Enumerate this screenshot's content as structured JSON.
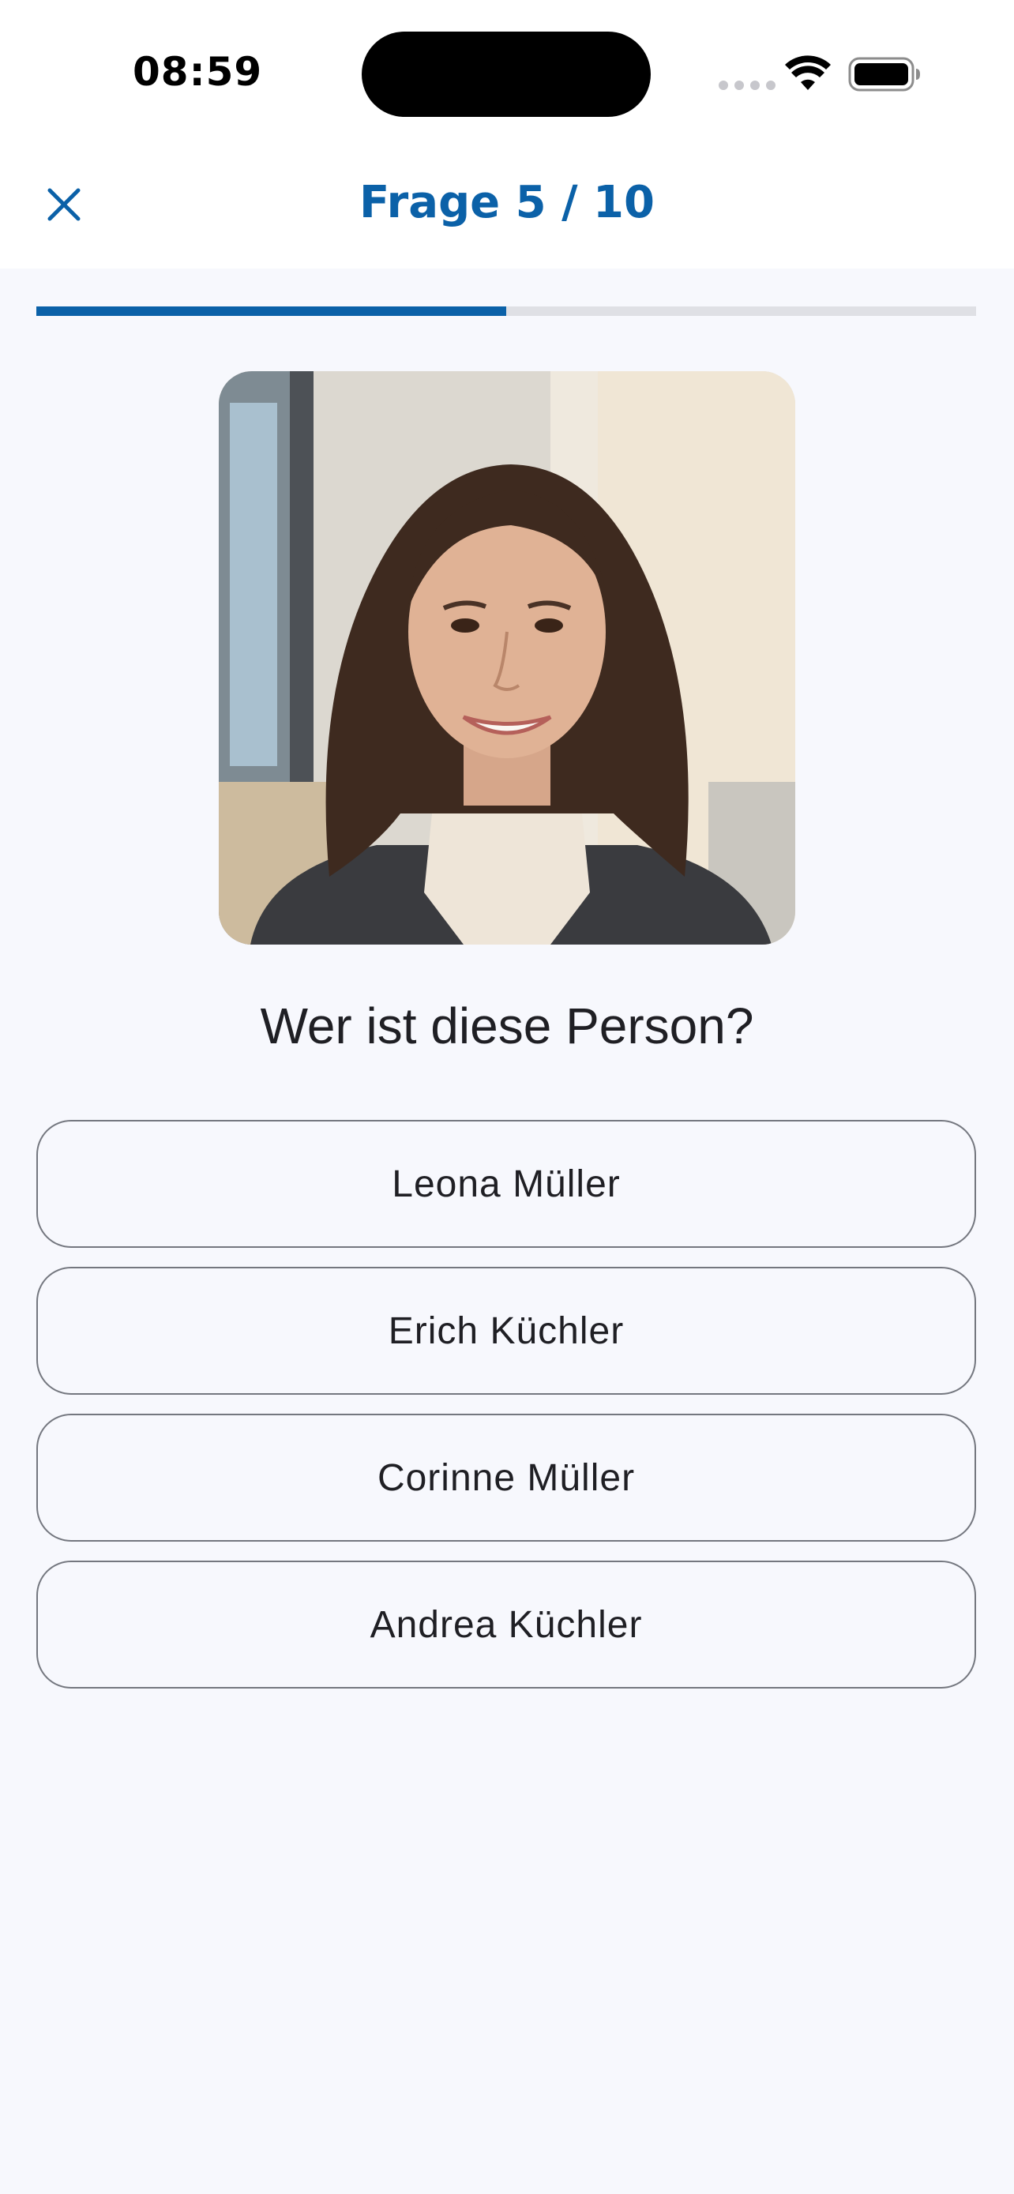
{
  "status_bar": {
    "time": "08:59"
  },
  "header": {
    "title": "Frage 5 / 10",
    "close_icon": "close-icon"
  },
  "progress": {
    "current": 5,
    "total": 10,
    "fraction": 0.5
  },
  "colors": {
    "accent": "#0b61a8",
    "background": "#f7f8fd",
    "track": "#dfe0e5"
  },
  "question": {
    "text": "Wer ist diese Person?"
  },
  "answers": [
    {
      "label": "Leona Müller"
    },
    {
      "label": "Erich Küchler"
    },
    {
      "label": "Corinne Müller"
    },
    {
      "label": "Andrea Küchler"
    }
  ]
}
